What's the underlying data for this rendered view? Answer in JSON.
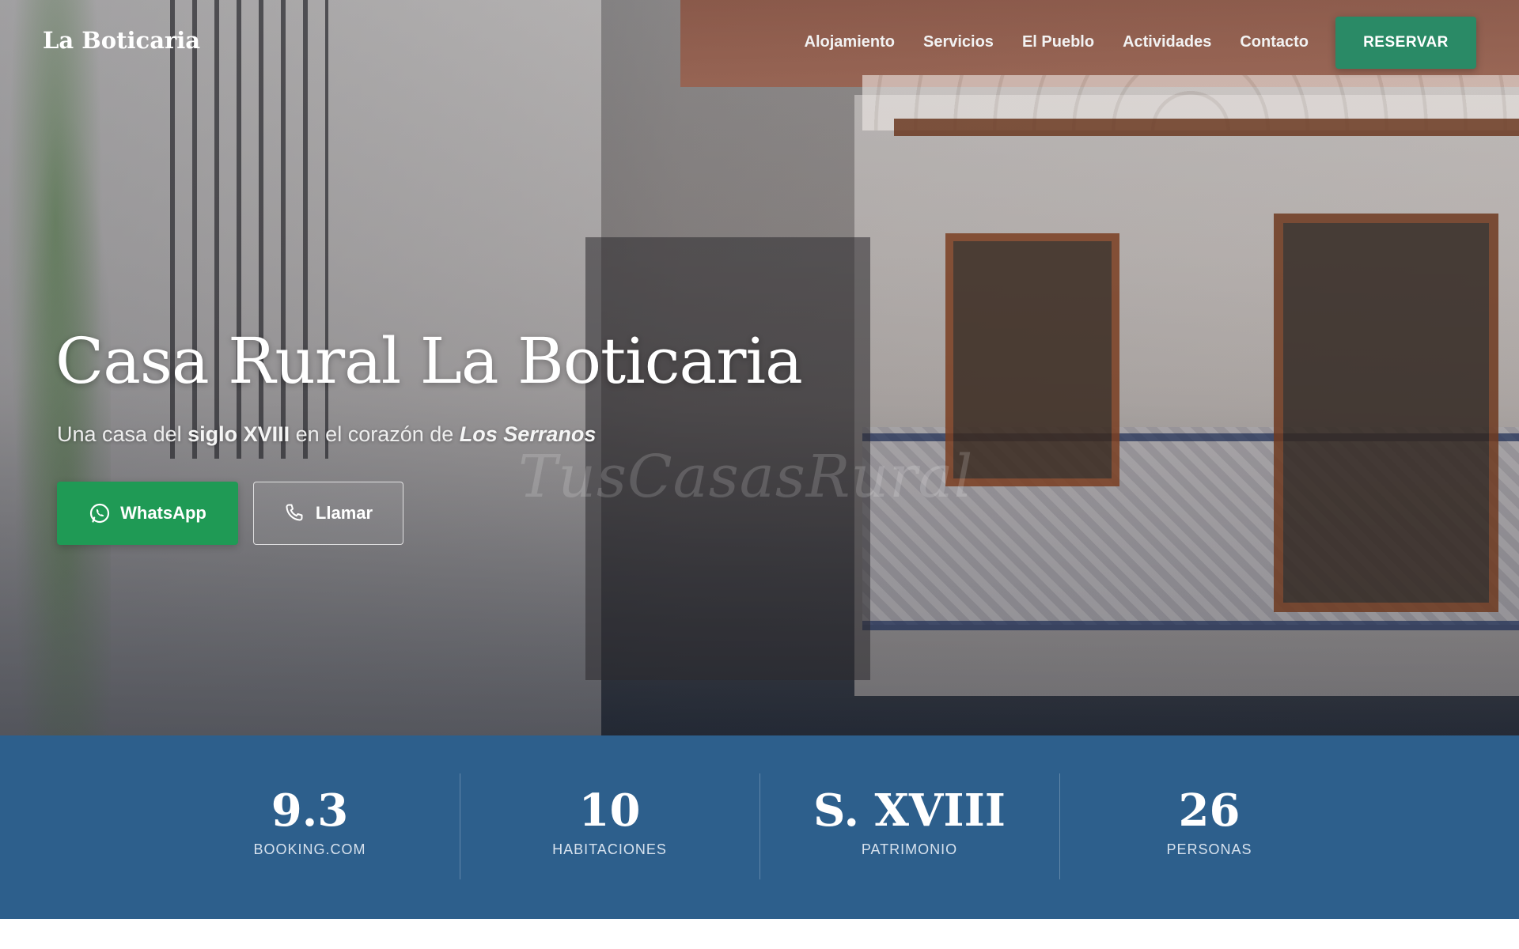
{
  "brand": "La Boticaria",
  "nav": {
    "links": [
      "Alojamiento",
      "Servicios",
      "El Pueblo",
      "Actividades",
      "Contacto"
    ],
    "reserve_label": "RESERVAR"
  },
  "hero": {
    "title": "Casa Rural La Boticaria",
    "subtitle": {
      "prefix": "Una casa del ",
      "bold": "siglo XVIII",
      "middle": " en el corazón de ",
      "italic": "Los Serranos"
    },
    "watermark": "TusCasasRural",
    "buttons": {
      "whatsapp": "WhatsApp",
      "call": "Llamar"
    }
  },
  "stats": [
    {
      "value": "9.3",
      "label": "BOOKING.COM"
    },
    {
      "value": "10",
      "label": "HABITACIONES"
    },
    {
      "value": "S. XVIII",
      "label": "PATRIMONIO"
    },
    {
      "value": "26",
      "label": "PERSONAS"
    }
  ],
  "colors": {
    "accent_green": "#2a8a66",
    "whatsapp_green": "#1f9a55",
    "stats_blue": "#2d5f8c"
  },
  "icons": {
    "whatsapp": "whatsapp-icon",
    "call": "phone-icon"
  }
}
